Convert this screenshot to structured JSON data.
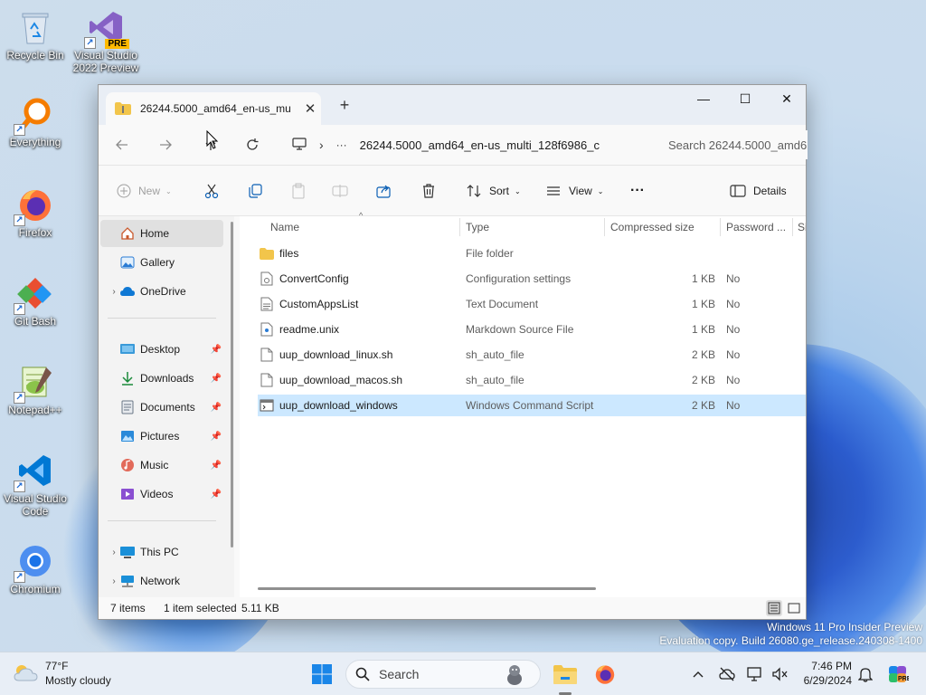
{
  "desktop": {
    "icons": [
      {
        "label": "Recycle Bin"
      },
      {
        "label": "Visual Studio 2022 Preview",
        "badge": "PRE"
      },
      {
        "label": "Everything"
      },
      {
        "label": "Firefox"
      },
      {
        "label": "Git Bash"
      },
      {
        "label": "Notepad++"
      },
      {
        "label": "Visual Studio Code"
      },
      {
        "label": "Chromium"
      }
    ],
    "watermark": {
      "line1": "Windows 11 Pro Insider Preview",
      "line2": "Evaluation copy. Build 26080.ge_release.240308-1400"
    }
  },
  "explorer": {
    "tab": {
      "title": "26244.5000_amd64_en-us_mu",
      "close": "✕"
    },
    "new_tab": "+",
    "window_controls": {
      "minimize": "—",
      "maximize": "☐",
      "close": "✕"
    },
    "address": {
      "path": "26244.5000_amd64_en-us_multi_128f6986_c",
      "more": "···",
      "chevron": "›"
    },
    "search_placeholder": "Search 26244.5000_amd6",
    "toolbar": {
      "new_label": "New",
      "sort_label": "Sort",
      "view_label": "View",
      "more_label": "···",
      "details_label": "Details"
    },
    "nav": {
      "home": "Home",
      "gallery": "Gallery",
      "onedrive": "OneDrive",
      "desktop": "Desktop",
      "downloads": "Downloads",
      "documents": "Documents",
      "pictures": "Pictures",
      "music": "Music",
      "videos": "Videos",
      "thispc": "This PC",
      "network": "Network"
    },
    "columns": {
      "name": "Name",
      "type": "Type",
      "compressed_size": "Compressed size",
      "password": "Password ...",
      "size": "Si"
    },
    "files": [
      {
        "name": "files",
        "type": "File folder",
        "size": "",
        "password": "",
        "icon": "folder-icon"
      },
      {
        "name": "ConvertConfig",
        "type": "Configuration settings",
        "size": "1 KB",
        "password": "No",
        "icon": "config-file-icon"
      },
      {
        "name": "CustomAppsList",
        "type": "Text Document",
        "size": "1 KB",
        "password": "No",
        "icon": "text-file-icon"
      },
      {
        "name": "readme.unix",
        "type": "Markdown Source File",
        "size": "1 KB",
        "password": "No",
        "icon": "markdown-file-icon"
      },
      {
        "name": "uup_download_linux.sh",
        "type": "sh_auto_file",
        "size": "2 KB",
        "password": "No",
        "icon": "generic-file-icon"
      },
      {
        "name": "uup_download_macos.sh",
        "type": "sh_auto_file",
        "size": "2 KB",
        "password": "No",
        "icon": "generic-file-icon"
      },
      {
        "name": "uup_download_windows",
        "type": "Windows Command Script",
        "size": "2 KB",
        "password": "No",
        "icon": "script-file-icon",
        "selected": true
      }
    ],
    "status": {
      "items": "7 items",
      "selected": "1 item selected",
      "selected_size": "5.11 KB"
    }
  },
  "taskbar": {
    "weather_temp": "77°F",
    "weather_desc": "Mostly cloudy",
    "search_label": "Search",
    "time": "7:46 PM",
    "date": "6/29/2024"
  },
  "colors": {
    "selection": "#cce8ff",
    "accent": "#0067c0",
    "folder": "#f2c54b"
  }
}
